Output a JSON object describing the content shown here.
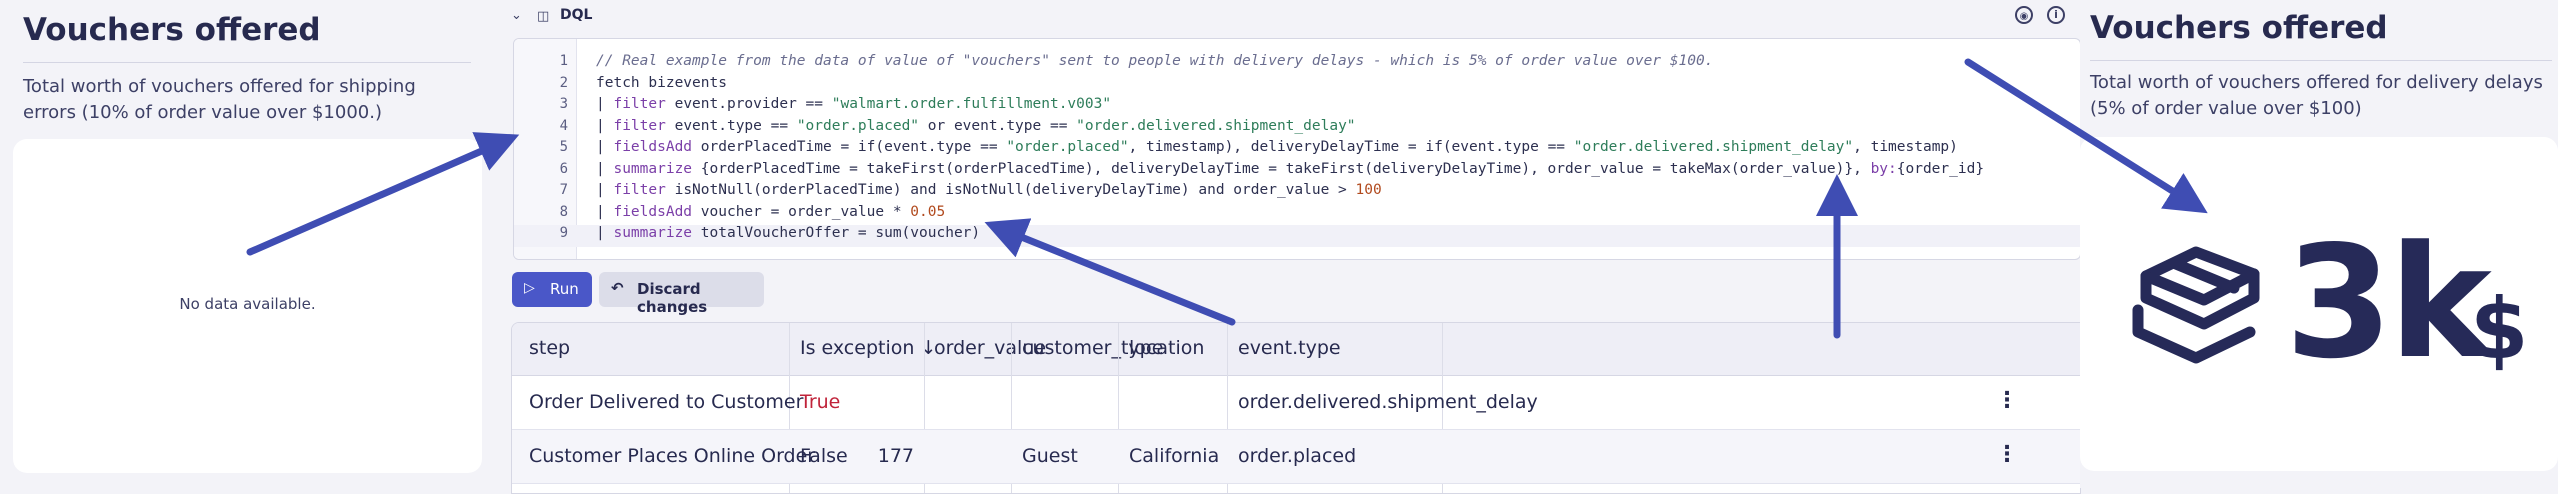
{
  "left_panel": {
    "title": "Vouchers offered",
    "description": "Total worth of vouchers offered for shipping errors (10% of order value over $1000.)",
    "empty_text": "No data available."
  },
  "dql": {
    "label": "DQL",
    "lines": [
      {
        "n": "1",
        "segments": [
          {
            "t": "// Real example from the data of value of \"vouchers\" sent to people with delivery delays - which is 5% of order value over $100.",
            "c": "cm"
          }
        ]
      },
      {
        "n": "2",
        "segments": [
          {
            "t": "fetch bizevents",
            "c": ""
          }
        ]
      },
      {
        "n": "3",
        "segments": [
          {
            "t": "| ",
            "c": ""
          },
          {
            "t": "filter",
            "c": "kw"
          },
          {
            "t": " event.provider == ",
            "c": ""
          },
          {
            "t": "\"walmart.order.fulfillment.v003\"",
            "c": "str"
          }
        ]
      },
      {
        "n": "4",
        "segments": [
          {
            "t": "| ",
            "c": ""
          },
          {
            "t": "filter",
            "c": "kw"
          },
          {
            "t": " event.type == ",
            "c": ""
          },
          {
            "t": "\"order.placed\"",
            "c": "str"
          },
          {
            "t": " or event.type == ",
            "c": ""
          },
          {
            "t": "\"order.delivered.shipment_delay\"",
            "c": "str"
          }
        ]
      },
      {
        "n": "5",
        "segments": [
          {
            "t": "| ",
            "c": ""
          },
          {
            "t": "fieldsAdd",
            "c": "kw"
          },
          {
            "t": " orderPlacedTime = if(event.type == ",
            "c": ""
          },
          {
            "t": "\"order.placed\"",
            "c": "str"
          },
          {
            "t": ", timestamp), deliveryDelayTime = if(event.type == ",
            "c": ""
          },
          {
            "t": "\"order.delivered.shipment_delay\"",
            "c": "str"
          },
          {
            "t": ", timestamp)",
            "c": ""
          }
        ]
      },
      {
        "n": "6",
        "segments": [
          {
            "t": "| ",
            "c": ""
          },
          {
            "t": "summarize",
            "c": "kw"
          },
          {
            "t": " {orderPlacedTime = takeFirst(orderPlacedTime), deliveryDelayTime = takeFirst(deliveryDelayTime), order_value = takeMax(order_value)}, ",
            "c": ""
          },
          {
            "t": "by:",
            "c": "kw"
          },
          {
            "t": "{order_id}",
            "c": ""
          }
        ]
      },
      {
        "n": "7",
        "segments": [
          {
            "t": "| ",
            "c": ""
          },
          {
            "t": "filter",
            "c": "kw"
          },
          {
            "t": " isNotNull(orderPlacedTime) and isNotNull(deliveryDelayTime) and order_value > ",
            "c": ""
          },
          {
            "t": "100",
            "c": "numv"
          }
        ]
      },
      {
        "n": "8",
        "segments": [
          {
            "t": "| ",
            "c": ""
          },
          {
            "t": "fieldsAdd",
            "c": "kw"
          },
          {
            "t": " voucher = order_value * ",
            "c": ""
          },
          {
            "t": "0.05",
            "c": "numv"
          }
        ]
      },
      {
        "n": "9",
        "segments": [
          {
            "t": "| ",
            "c": ""
          },
          {
            "t": "summarize",
            "c": "kw"
          },
          {
            "t": " totalVoucherOffer = sum(voucher)",
            "c": ""
          }
        ]
      }
    ]
  },
  "buttons": {
    "run": "Run",
    "discard": "Discard changes"
  },
  "table": {
    "columns": [
      "step",
      "Is exception ↓",
      "order_value",
      "customer_type",
      "location",
      "event.type"
    ],
    "rows": [
      {
        "step": "Order Delivered to Customer",
        "is_exception": "True",
        "order_value": "",
        "customer_type": "",
        "location": "",
        "event_type": "order.delivered.shipment_delay"
      },
      {
        "step": "Customer Places Online Order",
        "is_exception": "False",
        "order_value": "177",
        "customer_type": "Guest",
        "location": "California",
        "event_type": "order.placed"
      }
    ]
  },
  "right_panel": {
    "title": "Vouchers offered",
    "description": "Total worth of vouchers offered for delivery delays (5% of order value over $100)",
    "value": "3k",
    "unit": "$"
  },
  "colors": {
    "accent": "#4a57c8",
    "annotation_arrow": "#3f4db3",
    "exception_red": "#c0233a"
  }
}
